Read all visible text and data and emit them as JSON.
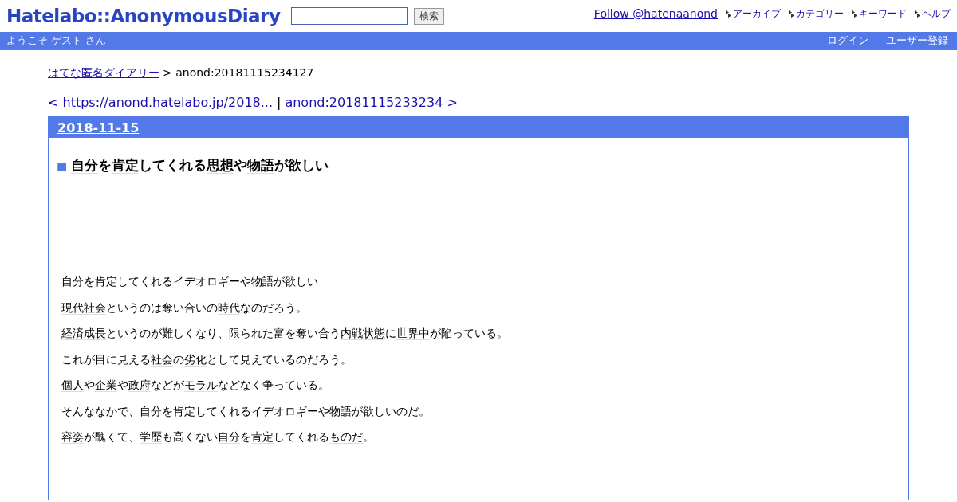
{
  "logo": "Hatelabo::AnonymousDiary",
  "search": {
    "button": "検索"
  },
  "follow_link": "Follow @hatenaanond",
  "nav_links": [
    "アーカイブ",
    "カテゴリー",
    "キーワード",
    "ヘルプ"
  ],
  "welcome": "ようこそ ゲスト さん",
  "account_links": [
    "ログイン",
    "ユーザー登録"
  ],
  "breadcrumb": {
    "link": "はてな匿名ダイアリー",
    "current": "> anond:20181115234127"
  },
  "pager": {
    "prev": "< https://anond.hatelabo.jp/2018...",
    "separator": "|",
    "next": "anond:20181115233234 >"
  },
  "day": {
    "date": "2018-11-15",
    "entry": {
      "marker": "■",
      "title": [
        {
          "text": "自分",
          "keyword": true
        },
        {
          "text": "を",
          "keyword": false
        },
        {
          "text": "肯定",
          "keyword": true
        },
        {
          "text": "してくれる",
          "keyword": false
        },
        {
          "text": "思想",
          "keyword": true
        },
        {
          "text": "や",
          "keyword": false
        },
        {
          "text": "物語",
          "keyword": true
        },
        {
          "text": "が欲しい",
          "keyword": false
        }
      ],
      "paragraphs": [
        [
          {
            "text": "自分",
            "keyword": true
          },
          {
            "text": "を",
            "keyword": false
          },
          {
            "text": "肯定",
            "keyword": true
          },
          {
            "text": "してくれる",
            "keyword": false
          },
          {
            "text": "イデオロギー",
            "keyword": true
          },
          {
            "text": "や",
            "keyword": false
          },
          {
            "text": "物語",
            "keyword": true
          },
          {
            "text": "が欲しい",
            "keyword": false
          }
        ],
        [
          {
            "text": "現代社会",
            "keyword": true
          },
          {
            "text": "というのは奪い合いの",
            "keyword": false
          },
          {
            "text": "時代",
            "keyword": true
          },
          {
            "text": "なのだろう。",
            "keyword": false
          }
        ],
        [
          {
            "text": "経済成長",
            "keyword": true
          },
          {
            "text": "というのが難しくなり、限られた富を奪い合う",
            "keyword": false
          },
          {
            "text": "内戦状態",
            "keyword": true
          },
          {
            "text": "に",
            "keyword": false
          },
          {
            "text": "世界中",
            "keyword": true
          },
          {
            "text": "が陥っている。",
            "keyword": false
          }
        ],
        [
          {
            "text": "これが目に見える",
            "keyword": false
          },
          {
            "text": "社会",
            "keyword": true
          },
          {
            "text": "の",
            "keyword": false
          },
          {
            "text": "劣化",
            "keyword": true
          },
          {
            "text": "として見えているのだろう。",
            "keyword": false
          }
        ],
        [
          {
            "text": "個人",
            "keyword": true
          },
          {
            "text": "や",
            "keyword": false
          },
          {
            "text": "企業",
            "keyword": true
          },
          {
            "text": "や",
            "keyword": false
          },
          {
            "text": "政府",
            "keyword": true
          },
          {
            "text": "などが",
            "keyword": false
          },
          {
            "text": "モラル",
            "keyword": true
          },
          {
            "text": "などなく争っている。",
            "keyword": false
          }
        ],
        [
          {
            "text": "そんななかで、",
            "keyword": false
          },
          {
            "text": "自分",
            "keyword": true
          },
          {
            "text": "を",
            "keyword": false
          },
          {
            "text": "肯定",
            "keyword": true
          },
          {
            "text": "してくれる",
            "keyword": false
          },
          {
            "text": "イデオロギー",
            "keyword": true
          },
          {
            "text": "や",
            "keyword": false
          },
          {
            "text": "物語",
            "keyword": true
          },
          {
            "text": "が欲しいのだ。",
            "keyword": false
          }
        ],
        [
          {
            "text": "容姿",
            "keyword": true
          },
          {
            "text": "が醜くて、",
            "keyword": false
          },
          {
            "text": "学歴",
            "keyword": true
          },
          {
            "text": "も高くない",
            "keyword": false
          },
          {
            "text": "自分",
            "keyword": true
          },
          {
            "text": "を",
            "keyword": false
          },
          {
            "text": "肯定",
            "keyword": true
          },
          {
            "text": "してくれる",
            "keyword": false
          },
          {
            "text": "ものだ",
            "keyword": true
          },
          {
            "text": "。",
            "keyword": false
          }
        ]
      ]
    }
  }
}
